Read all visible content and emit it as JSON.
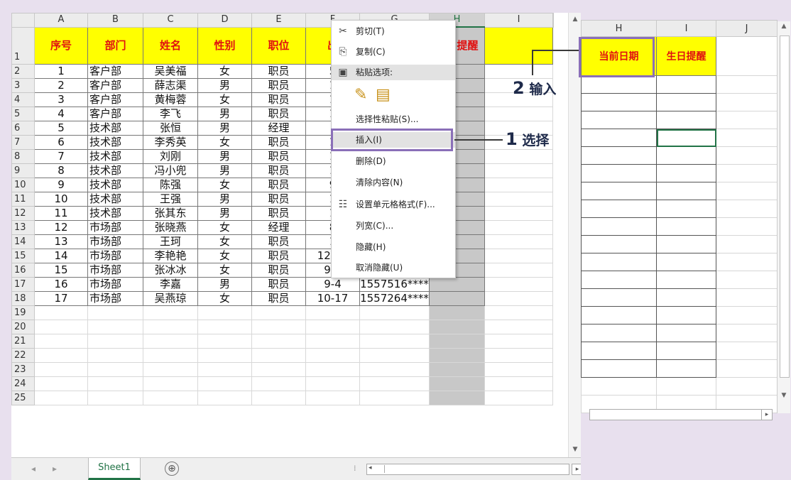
{
  "sheet": {
    "column_letters": [
      "A",
      "B",
      "C",
      "D",
      "E",
      "F",
      "G",
      "H",
      "I"
    ],
    "row_numbers": [
      "1",
      "2",
      "3",
      "4",
      "5",
      "6",
      "7",
      "8",
      "9",
      "10",
      "11",
      "12",
      "13",
      "14",
      "15",
      "16",
      "17",
      "18",
      "19",
      "20",
      "21",
      "22",
      "23",
      "24",
      "25"
    ],
    "headers": [
      "序号",
      "部门",
      "姓名",
      "性别",
      "职位",
      "出",
      "",
      "生日提醒"
    ],
    "rows": [
      [
        "1",
        "客户部",
        "吴美福",
        "女",
        "职员",
        "5",
        ""
      ],
      [
        "2",
        "客户部",
        "薛志渠",
        "男",
        "职员",
        "1",
        ""
      ],
      [
        "3",
        "客户部",
        "黄梅蓉",
        "女",
        "职员",
        "1",
        ""
      ],
      [
        "4",
        "客户部",
        "李飞",
        "男",
        "职员",
        "1",
        ""
      ],
      [
        "5",
        "技术部",
        "张恒",
        "男",
        "经理",
        "",
        ""
      ],
      [
        "6",
        "技术部",
        "李秀英",
        "女",
        "职员",
        "1",
        ""
      ],
      [
        "7",
        "技术部",
        "刘刚",
        "男",
        "职员",
        "1",
        ""
      ],
      [
        "8",
        "技术部",
        "冯小兜",
        "男",
        "职员",
        "1",
        ""
      ],
      [
        "9",
        "技术部",
        "陈强",
        "女",
        "职员",
        "9",
        ""
      ],
      [
        "10",
        "技术部",
        "王强",
        "男",
        "职员",
        "1",
        ""
      ],
      [
        "11",
        "技术部",
        "张其东",
        "男",
        "职员",
        "1",
        ""
      ],
      [
        "12",
        "市场部",
        "张晓燕",
        "女",
        "经理",
        "8",
        ""
      ],
      [
        "13",
        "市场部",
        "王珂",
        "女",
        "职员",
        "1",
        ""
      ],
      [
        "14",
        "市场部",
        "李艳艳",
        "女",
        "职员",
        "12-12",
        "1557624****"
      ],
      [
        "15",
        "市场部",
        "张冰冰",
        "女",
        "职员",
        "9-9",
        "1557525****"
      ],
      [
        "16",
        "市场部",
        "李嘉",
        "男",
        "职员",
        "9-4",
        "1557516****"
      ],
      [
        "17",
        "市场部",
        "吴燕琼",
        "女",
        "职员",
        "10-17",
        "1557264****"
      ]
    ],
    "tab_name": "Sheet1",
    "add_sheet": "⊕",
    "tab_prev": "◂",
    "tab_next": "▸",
    "tab_dots": "⁞"
  },
  "context_menu": {
    "items": [
      {
        "label": "剪切(T)",
        "icon": "scissors-icon",
        "glyph": "✂"
      },
      {
        "label": "复制(C)",
        "icon": "copy-icon",
        "glyph": "⎘"
      },
      {
        "label": "粘贴选项:",
        "icon": "paste-icon",
        "glyph": "📋"
      },
      {
        "label": "选择性粘贴(S)...",
        "icon": "",
        "glyph": ""
      },
      {
        "label": "插入(I)",
        "icon": "",
        "glyph": ""
      },
      {
        "label": "删除(D)",
        "icon": "",
        "glyph": ""
      },
      {
        "label": "清除内容(N)",
        "icon": "",
        "glyph": ""
      },
      {
        "label": "设置单元格格式(F)...",
        "icon": "format-cells-icon",
        "glyph": "☷"
      },
      {
        "label": "列宽(C)...",
        "icon": "",
        "glyph": ""
      },
      {
        "label": "隐藏(H)",
        "icon": "",
        "glyph": ""
      },
      {
        "label": "取消隐藏(U)",
        "icon": "",
        "glyph": ""
      }
    ],
    "paste_option_icons": [
      "paste-format-icon",
      "paste-values-icon"
    ]
  },
  "right_sheet": {
    "column_letters": [
      "H",
      "I",
      "J"
    ],
    "headers": [
      "当前日期",
      "生日提醒"
    ]
  },
  "annotations": {
    "step1_num": "1",
    "step1_text": "选择",
    "step2_num": "2",
    "step2_text": "输入"
  },
  "colors": {
    "header_fill": "#ffff00",
    "header_text": "#e01010",
    "highlight_box": "#8a6fb8",
    "selection_green": "#217346",
    "background": "#e8e0ee"
  }
}
